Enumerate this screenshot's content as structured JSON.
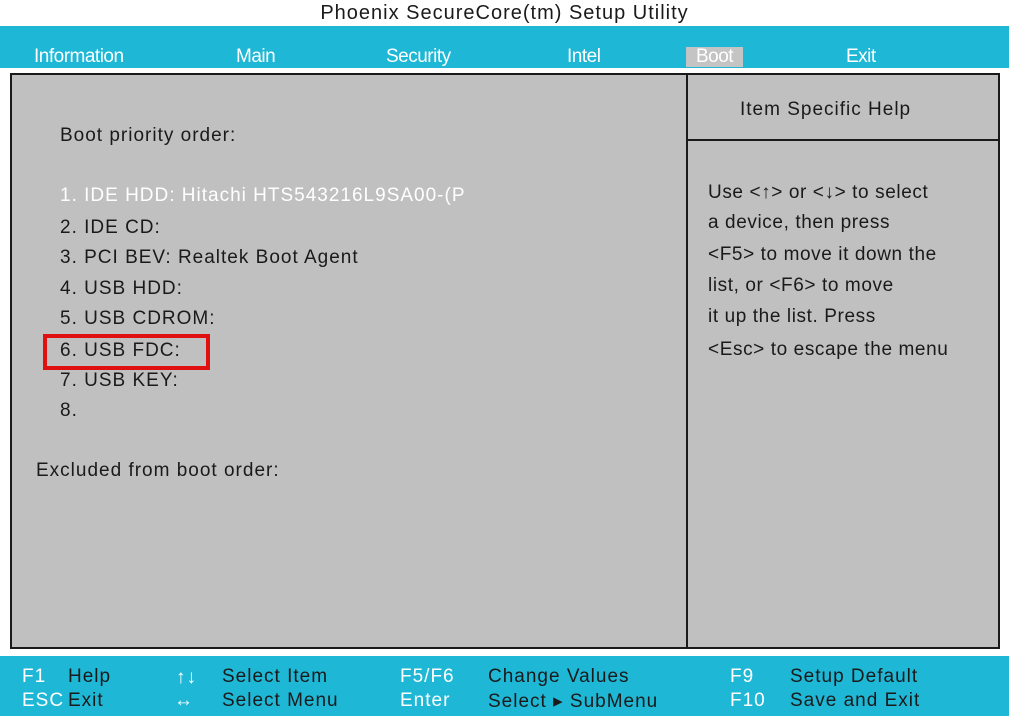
{
  "title": "Phoenix SecureCore(tm) Setup Utility",
  "tabs": [
    {
      "label": "Information"
    },
    {
      "label": "Main"
    },
    {
      "label": "Security"
    },
    {
      "label": "Intel"
    },
    {
      "label": "Boot"
    },
    {
      "label": "Exit"
    }
  ],
  "active_tab": "Boot",
  "boot": {
    "priority_heading": "Boot priority order:",
    "items": [
      "1. IDE HDD: Hitachi HTS543216L9SA00-(P",
      "2. IDE CD:",
      "3. PCI BEV: Realtek Boot Agent",
      "4. USB HDD:",
      "5. USB CDROM:",
      "6. USB FDC:",
      "7. USB KEY:",
      "8."
    ],
    "excluded_heading": "Excluded from boot order:"
  },
  "help": {
    "title": "Item Specific Help",
    "lines": [
      "Use <↑> or <↓> to select",
      "a device, then press",
      "<F5> to move it down the",
      "list, or <F6> to move",
      "it up the list. Press",
      "<Esc> to escape the menu"
    ]
  },
  "footer": {
    "row1": {
      "f1_key": "F1",
      "f1_desc": "Help",
      "arrows_ud": "↑↓",
      "arrows_ud_desc": "Select Item",
      "f5f6_key": "F5/F6",
      "f5f6_desc": "Change Values",
      "f9_key": "F9",
      "f9_desc": "Setup Default"
    },
    "row2": {
      "esc_key": "ESC",
      "esc_desc": "Exit",
      "arrows_lr": "↔",
      "arrows_lr_desc": "Select Menu",
      "enter_key": "Enter",
      "enter_desc": "Select ▸ SubMenu",
      "f10_key": "F10",
      "f10_desc": "Save and Exit"
    }
  },
  "colors": {
    "menubar": "#1fb7d6",
    "panel": "#c0c0c0",
    "highlight": "#e01010"
  }
}
